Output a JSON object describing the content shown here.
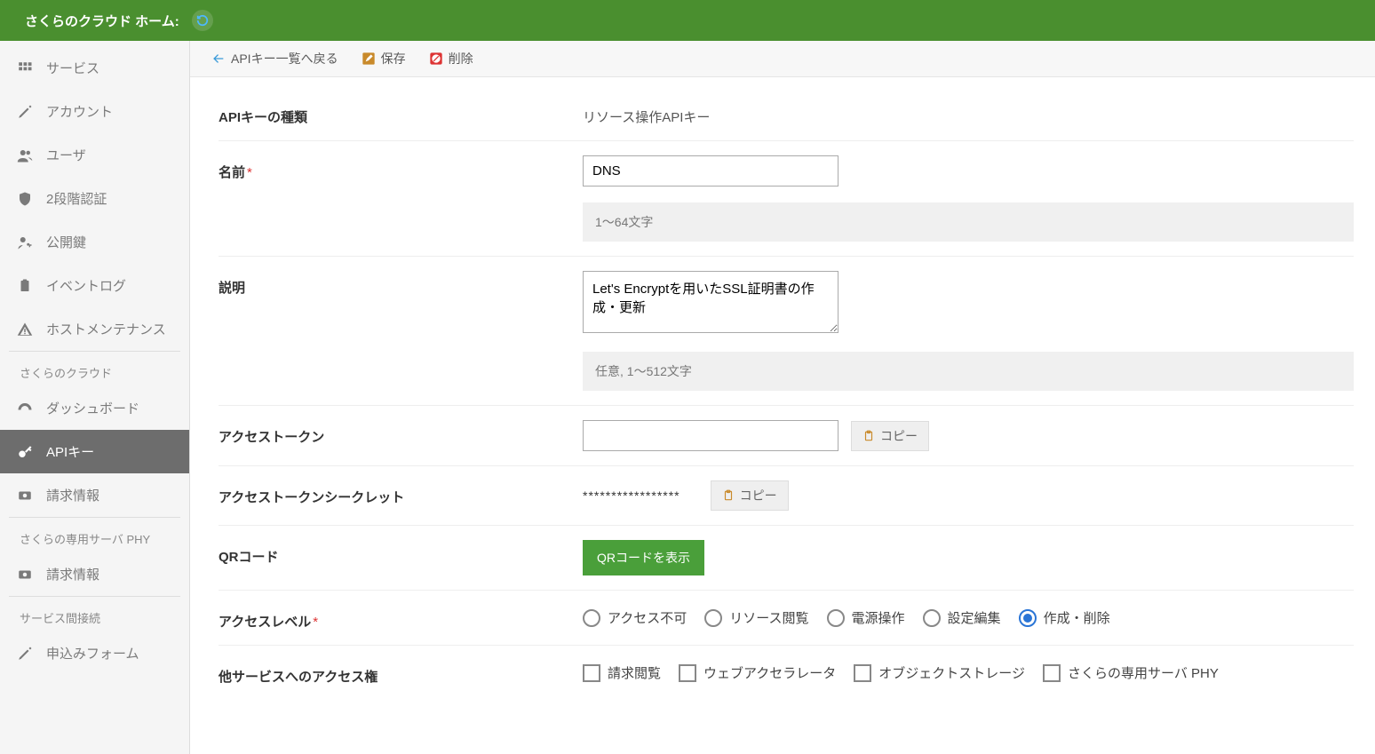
{
  "header": {
    "title": "さくらのクラウド ホーム:"
  },
  "sidebar": {
    "groups": [
      {
        "label": "",
        "items": [
          {
            "name": "services",
            "label": "サービス",
            "icon": "th"
          },
          {
            "name": "account",
            "label": "アカウント",
            "icon": "pen"
          },
          {
            "name": "user",
            "label": "ユーザ",
            "icon": "users"
          },
          {
            "name": "2fa",
            "label": "2段階認証",
            "icon": "shield"
          },
          {
            "name": "ssh-keys",
            "label": "公開鍵",
            "icon": "key-person"
          },
          {
            "name": "event-log",
            "label": "イベントログ",
            "icon": "clipboard"
          },
          {
            "name": "host-maint",
            "label": "ホストメンテナンス",
            "icon": "warn"
          }
        ]
      },
      {
        "label": "さくらのクラウド",
        "items": [
          {
            "name": "dashboard",
            "label": "ダッシュボード",
            "icon": "gauge"
          },
          {
            "name": "api-key",
            "label": "APIキー",
            "icon": "key",
            "active": true
          },
          {
            "name": "billing",
            "label": "請求情報",
            "icon": "bill"
          }
        ]
      },
      {
        "label": "さくらの専用サーバ PHY",
        "items": [
          {
            "name": "billing-phy",
            "label": "請求情報",
            "icon": "bill"
          }
        ]
      },
      {
        "label": "サービス間接続",
        "items": [
          {
            "name": "apply-form",
            "label": "申込みフォーム",
            "icon": "pen"
          }
        ]
      }
    ]
  },
  "toolbar": {
    "back": "APIキー一覧へ戻る",
    "save": "保存",
    "delete": "削除"
  },
  "form": {
    "apikey_type_label": "APIキーの種類",
    "apikey_type_value": "リソース操作APIキー",
    "name_label": "名前",
    "name_value": "DNS",
    "name_hint": "1〜64文字",
    "desc_label": "説明",
    "desc_value": "Let's Encryptを用いたSSL証明書の作成・更新",
    "desc_hint": "任意, 1〜512文字",
    "token_label": "アクセストークン",
    "token_value": "",
    "copy_label": "コピー",
    "secret_label": "アクセストークンシークレット",
    "secret_mask": "*****************",
    "qr_label": "QRコード",
    "qr_button": "QRコードを表示",
    "level_label": "アクセスレベル",
    "level_options": [
      {
        "label": "アクセス不可",
        "selected": false
      },
      {
        "label": "リソース閲覧",
        "selected": false
      },
      {
        "label": "電源操作",
        "selected": false
      },
      {
        "label": "設定編集",
        "selected": false
      },
      {
        "label": "作成・削除",
        "selected": true
      }
    ],
    "other_label": "他サービスへのアクセス権",
    "other_options": [
      {
        "label": "請求閲覧"
      },
      {
        "label": "ウェブアクセラレータ"
      },
      {
        "label": "オブジェクトストレージ"
      },
      {
        "label": "さくらの専用サーバ PHY"
      }
    ]
  }
}
